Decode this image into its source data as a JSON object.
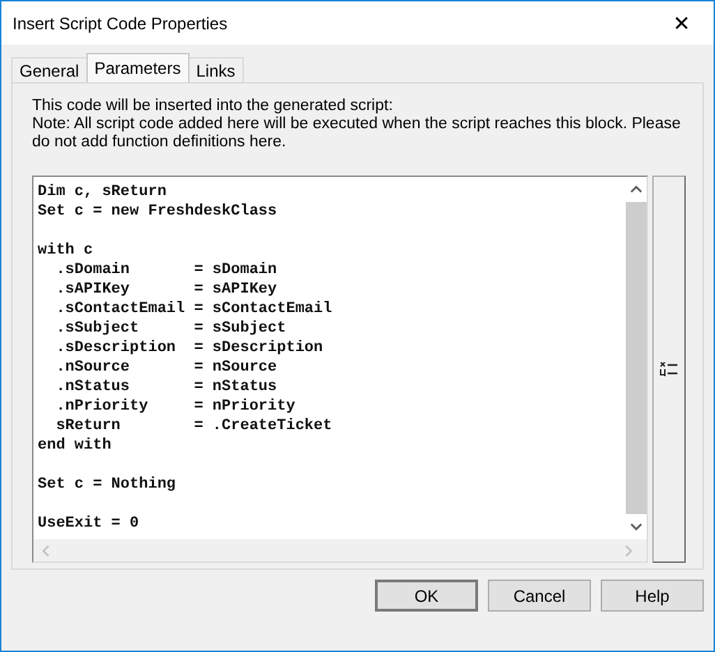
{
  "window": {
    "title": "Insert Script Code Properties",
    "close": "✕"
  },
  "tabs": [
    {
      "label": "General",
      "selected": false
    },
    {
      "label": "Parameters",
      "selected": true
    },
    {
      "label": "Links",
      "selected": false
    }
  ],
  "intro": "This code will be inserted into the generated script:",
  "note": "Note: All script code added here will be executed when the script reaches this block. Please do not add function definitions here.",
  "code": "Dim c, sReturn\nSet c = new FreshdeskClass\n\nwith c\n  .sDomain       = sDomain\n  .sAPIKey       = sAPIKey\n  .sContactEmail = sContactEmail\n  .sSubject      = sSubject\n  .sDescription  = sDescription\n  .nSource       = nSource\n  .nStatus       = nStatus\n  .nPriority     = nPriority\n  sReturn        = .CreateTicket\nend with\n\nSet c = Nothing\n\nUseExit = 0",
  "buttons": [
    "OK",
    "Cancel",
    "Help"
  ]
}
